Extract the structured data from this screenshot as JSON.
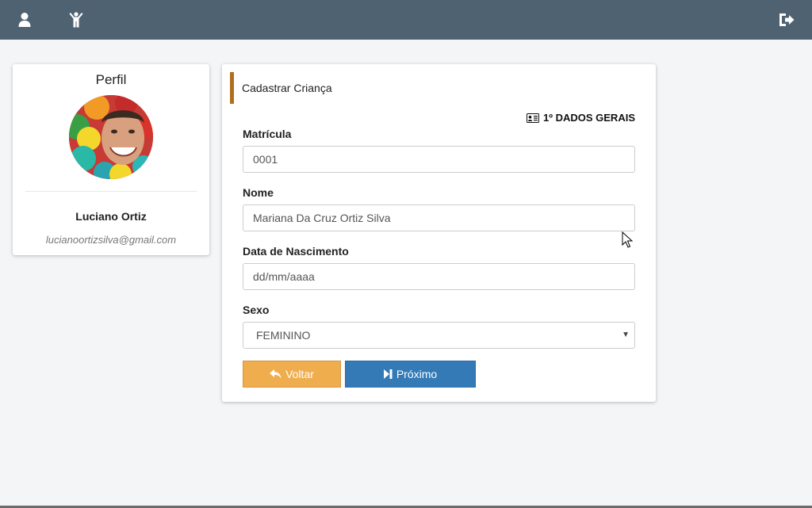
{
  "topbar": {
    "icons": [
      "user-icon",
      "child-icon",
      "sign-out-icon"
    ]
  },
  "profile": {
    "title": "Perfil",
    "name": "Luciano Ortiz",
    "email": "lucianoortizsilva@gmail.com"
  },
  "form": {
    "header": "Cadastrar Criança",
    "section": "1º DADOS GERAIS",
    "matricula_label": "Matrícula",
    "matricula_value": "0001",
    "nome_label": "Nome",
    "nome_value": "Mariana Da Cruz Ortiz Silva",
    "nascimento_label": "Data de Nascimento",
    "nascimento_placeholder": "dd/mm/aaaa",
    "sexo_label": "Sexo",
    "sexo_value": "FEMININO",
    "back_label": "Voltar",
    "next_label": "Próximo"
  },
  "colors": {
    "topbar": "#4f6272",
    "accent_bar": "#b06f1c",
    "back_button": "#f0ad4e",
    "next_button": "#337ab7"
  }
}
